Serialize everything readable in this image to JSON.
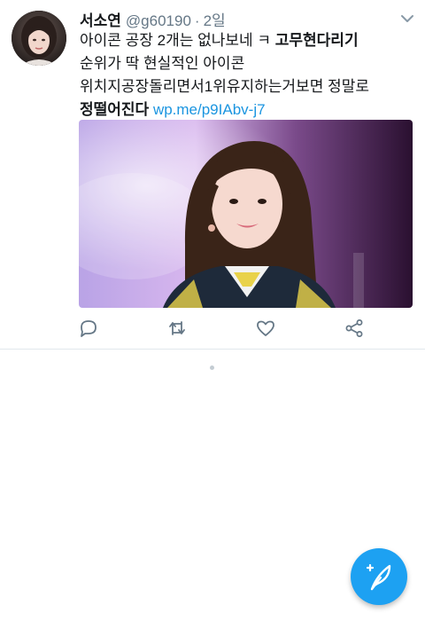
{
  "tweet": {
    "display_name": "서소연",
    "handle": "@g60190",
    "separator": "·",
    "time": "2일",
    "text_line1_normal": "아이콘 공장 2개는 없나보네 ㅋ ",
    "text_line1_bold": "고무현다리기",
    "text_line2": "순위가 딱 현실적인 아이콘",
    "text_line3": "위치지공장돌리면서1위유지하는거보면 정말로",
    "text_line4_bold": "정떨어진다",
    "link": "wp.me/p9IAbv-j7",
    "avatar_icon": "profile-photo",
    "media_icon": "photo-girl-on-stage"
  },
  "actions": {
    "reply_icon": "reply-icon",
    "retweet_icon": "retweet-icon",
    "like_icon": "heart-icon",
    "share_icon": "share-icon"
  },
  "fab": {
    "icon": "compose-tweet-icon",
    "color": "#1da1f2"
  },
  "colors": {
    "accent": "#1da1f2",
    "link": "#1b95e0",
    "secondary_text": "#657786",
    "icon_gray": "#657786",
    "divider": "#e1e8ed"
  }
}
